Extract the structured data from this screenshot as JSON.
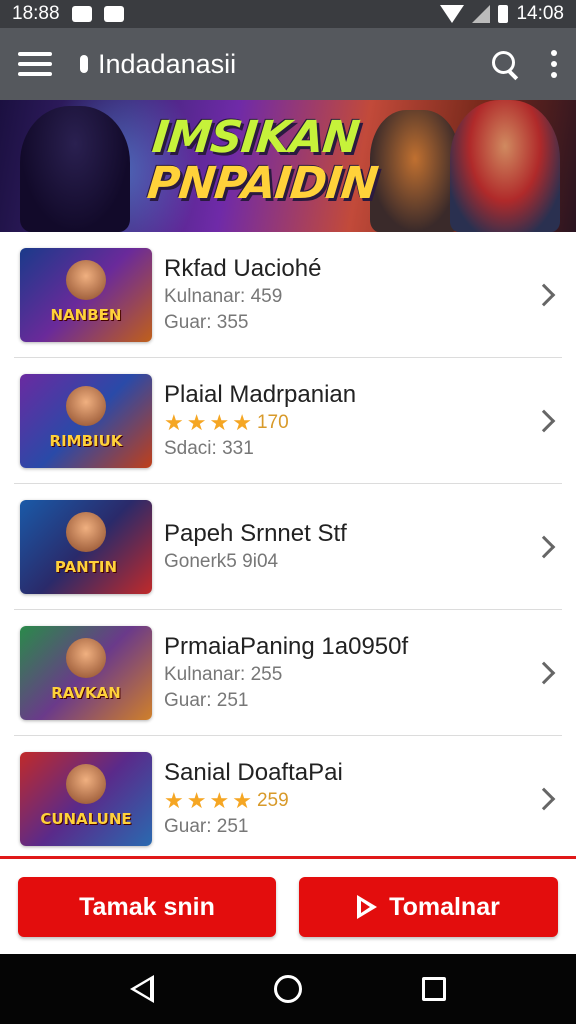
{
  "status_bar": {
    "time_left": "18:88",
    "time_right": "14:08"
  },
  "app_bar": {
    "title": "Indadanasii"
  },
  "banner": {
    "line1": "IMSIKAN",
    "line2": "PNPAIDIN"
  },
  "games": [
    {
      "title": "Rkfad Uaciohé",
      "thumb_text": "NANBEN",
      "line1": "Kulnanar: 459",
      "line2": "Guar: 355",
      "rating": null
    },
    {
      "title": "Plaial Madrpanian",
      "thumb_text": "RIMBIUK",
      "line1": null,
      "rating": {
        "stars": 4,
        "value": "170"
      },
      "line2": "Sdaci: 331"
    },
    {
      "title": "Papeh Srnnet Stf",
      "thumb_text": "PANTIN",
      "line1": "Gonerk5 9i04",
      "line2": null,
      "rating": null
    },
    {
      "title": "PrmaiaPaning 1a0950f",
      "thumb_text": "RAVKAN",
      "line1": "Kulnanar: 255",
      "line2": "Guar: 251",
      "rating": null
    },
    {
      "title": "Sanial DoaftaPai",
      "thumb_text": "CUNALUNE",
      "line1": null,
      "rating": {
        "stars": 4,
        "value": "259"
      },
      "line2": "Guar: 251"
    }
  ],
  "actions": {
    "left_label": "Tamak snin",
    "right_label": "Tomalnar"
  },
  "colors": {
    "accent_red": "#e30d0d",
    "app_bar": "#55585d",
    "star": "#f5a623"
  },
  "icons": [
    "menu-icon",
    "search-icon",
    "more-icon",
    "chevron-right-icon",
    "play-icon",
    "nav-back-icon",
    "nav-home-icon",
    "nav-recent-icon"
  ]
}
